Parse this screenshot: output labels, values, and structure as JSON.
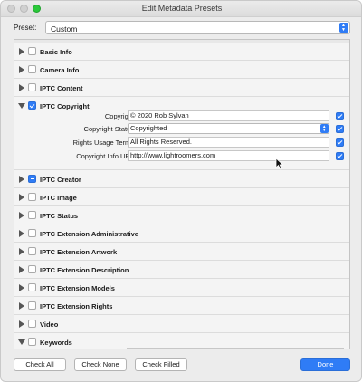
{
  "window": {
    "title": "Edit Metadata Presets"
  },
  "preset": {
    "label": "Preset:",
    "value": "Custom"
  },
  "sections_top": [
    {
      "label": "Basic Info",
      "state": "unchecked"
    },
    {
      "label": "Camera Info",
      "state": "unchecked"
    },
    {
      "label": "IPTC Content",
      "state": "unchecked"
    }
  ],
  "copyright": {
    "label": "IPTC Copyright",
    "fields": [
      {
        "label": "Copyright",
        "value": "© 2020 Rob Sylvan",
        "type": "text"
      },
      {
        "label": "Copyright Status",
        "value": "Copyrighted",
        "type": "select"
      },
      {
        "label": "Rights Usage Terms",
        "value": "All Rights Reserved.",
        "type": "text"
      },
      {
        "label": "Copyright Info URL",
        "value": "http://www.lightroomers.com",
        "type": "text"
      }
    ]
  },
  "sections_bottom": [
    {
      "label": "IPTC Creator",
      "state": "mixed"
    },
    {
      "label": "IPTC Image",
      "state": "unchecked"
    },
    {
      "label": "IPTC Status",
      "state": "unchecked"
    },
    {
      "label": "IPTC Extension Administrative",
      "state": "unchecked"
    },
    {
      "label": "IPTC Extension Artwork",
      "state": "unchecked"
    },
    {
      "label": "IPTC Extension Description",
      "state": "unchecked"
    },
    {
      "label": "IPTC Extension Models",
      "state": "unchecked"
    },
    {
      "label": "IPTC Extension Rights",
      "state": "unchecked"
    },
    {
      "label": "Video",
      "state": "unchecked"
    }
  ],
  "keywords": {
    "label": "Keywords"
  },
  "buttons": {
    "check_all": "Check All",
    "check_none": "Check None",
    "check_filled": "Check Filled",
    "done": "Done"
  }
}
